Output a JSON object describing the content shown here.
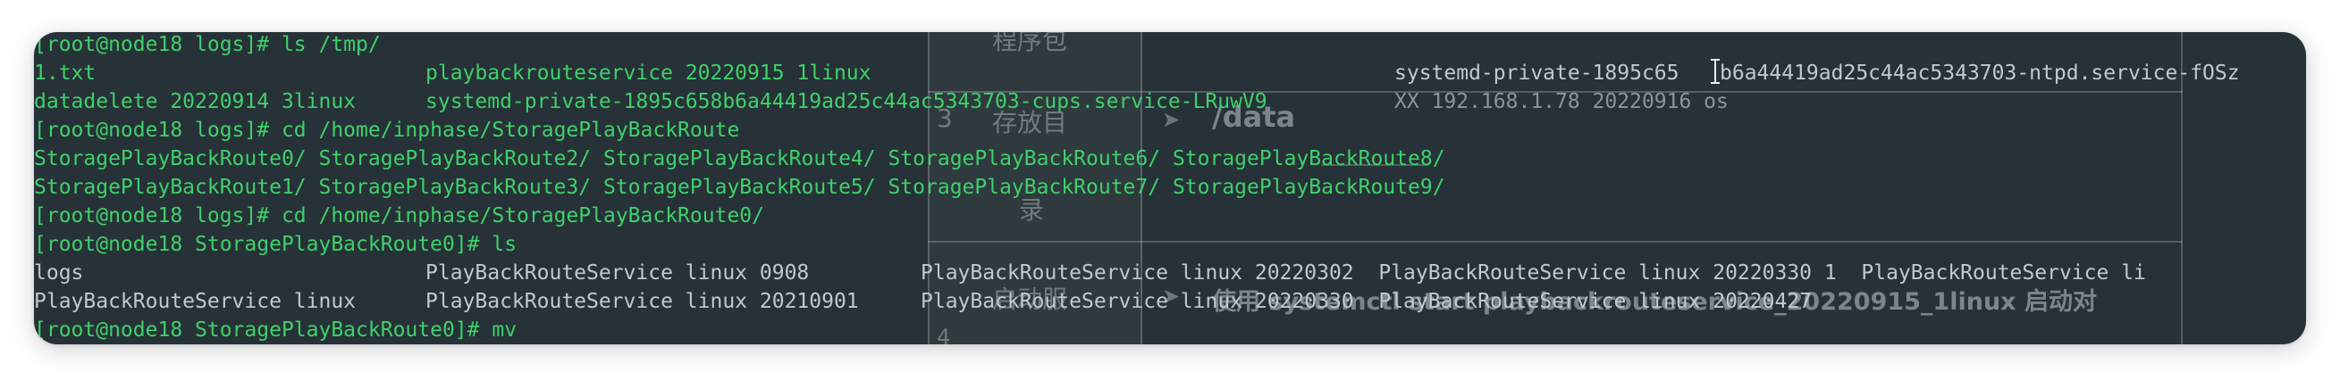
{
  "terminal": {
    "line1": "[root@node18 logs]# ls /tmp/",
    "line2_a": "1.txt",
    "line2_b": "playbackrouteservice 20220915 1linux",
    "line2_c": "systemd-private-1895c65",
    "line2_d": "b6a44419ad25c44ac5343703-ntpd.service-fOSz",
    "line3_a": "datadelete 20220914 3linux",
    "line3_b": "systemd-private-1895c658b6a44419ad25c44ac5343703-cups.service-LRuwV9",
    "line3_c": "XX 192.168.1.78 20220916 os",
    "line4": "[root@node18 logs]# cd /home/inphase/StoragePlayBackRoute",
    "line5": "StoragePlayBackRoute0/ StoragePlayBackRoute2/ StoragePlayBackRoute4/ StoragePlayBackRoute6/ StoragePlayBackRoute8/",
    "line6": "StoragePlayBackRoute1/ StoragePlayBackRoute3/ StoragePlayBackRoute5/ StoragePlayBackRoute7/ StoragePlayBackRoute9/",
    "line7": "[root@node18 logs]# cd /home/inphase/StoragePlayBackRoute0/",
    "line8": "[root@node18 StoragePlayBackRoute0]# ls",
    "line9_a": "logs",
    "line9_b": "PlayBackRouteService linux 0908",
    "line9_c": "PlayBackRouteService linux 20220302  PlayBackRouteService linux 20220330 1  PlayBackRouteService li",
    "line10_a": "PlayBackRouteService linux",
    "line10_b": "PlayBackRouteService linux 20210901",
    "line10_c": "PlayBackRouteService linux 20220330  PlayBackRouteService linux 20220427",
    "line11": "[root@node18 StoragePlayBackRoute0]# mv"
  },
  "overlay": {
    "row1_label": "程序包",
    "row2_num": "3",
    "row2_label": "存放目",
    "row2_arrow": "➤",
    "row2_value": "/data",
    "row2_label_cont": "录",
    "row3_label": "启动服",
    "row3_arrow": "➤",
    "row3_value": "使用 systemctl start playbackrouteservice_20220915_1linux 启动对",
    "row4_num": "4"
  }
}
